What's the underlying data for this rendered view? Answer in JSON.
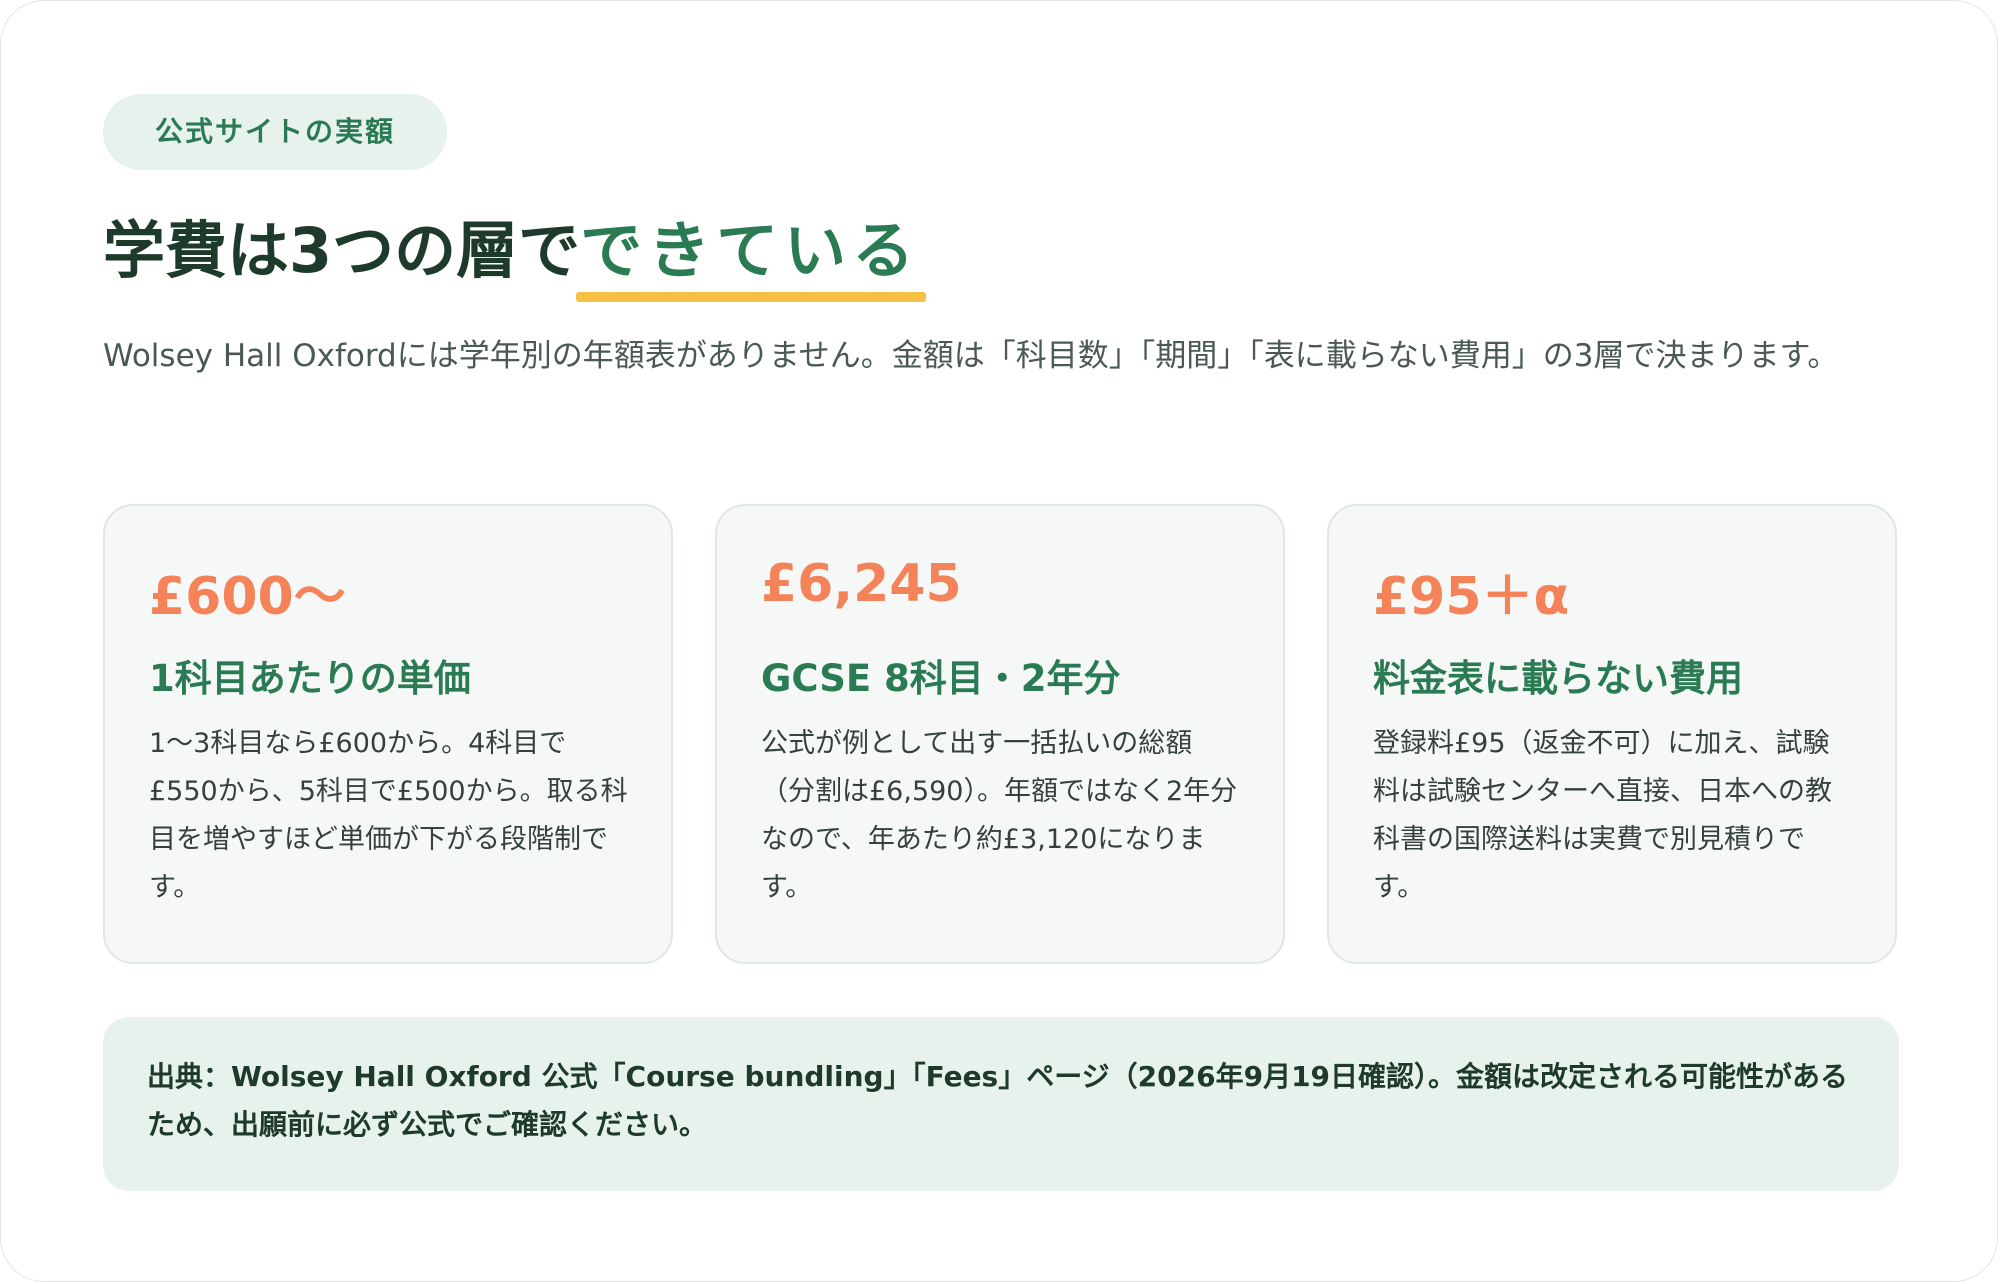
{
  "tag": "公式サイトの実額",
  "headline": {
    "main": "学費は3つの層で",
    "accent": "できている"
  },
  "intro": "Wolsey Hall Oxfordには学年別の年額表がありません。金額は「科目数」「期間」「表に載らない費用」の3層で決まります。",
  "cards": [
    {
      "amount": "£600〜",
      "title": "1科目あたりの単価",
      "body": "1〜3科目なら£600から。4科目で£550から、5科目で£500から。取る科目を増やすほど単価が下がる段階制です。"
    },
    {
      "amount": "£6,245",
      "title": "GCSE 8科目・2年分",
      "body": "公式が例として出す一括払いの総額（分割は£6,590）。年額ではなく2年分なので、年あたり約£3,120になります。"
    },
    {
      "amount": "£95＋α",
      "title": "料金表に載らない費用",
      "body": "登録料£95（返金不可）に加え、試験料は試験センターへ直接、日本への教科書の国際送料は実費で別見積りです。"
    }
  ],
  "source": "出典：Wolsey Hall Oxford 公式「Course bundling」「Fees」ページ（2026年9月19日確認）。金額は改定される可能性があるため、出願前に必ず公式でご確認ください。",
  "colors": {
    "accent_green": "#2a7a54",
    "amount_orange": "#f4835a",
    "underline_yellow": "#f6c044",
    "tag_bg": "#e7f2ec"
  }
}
